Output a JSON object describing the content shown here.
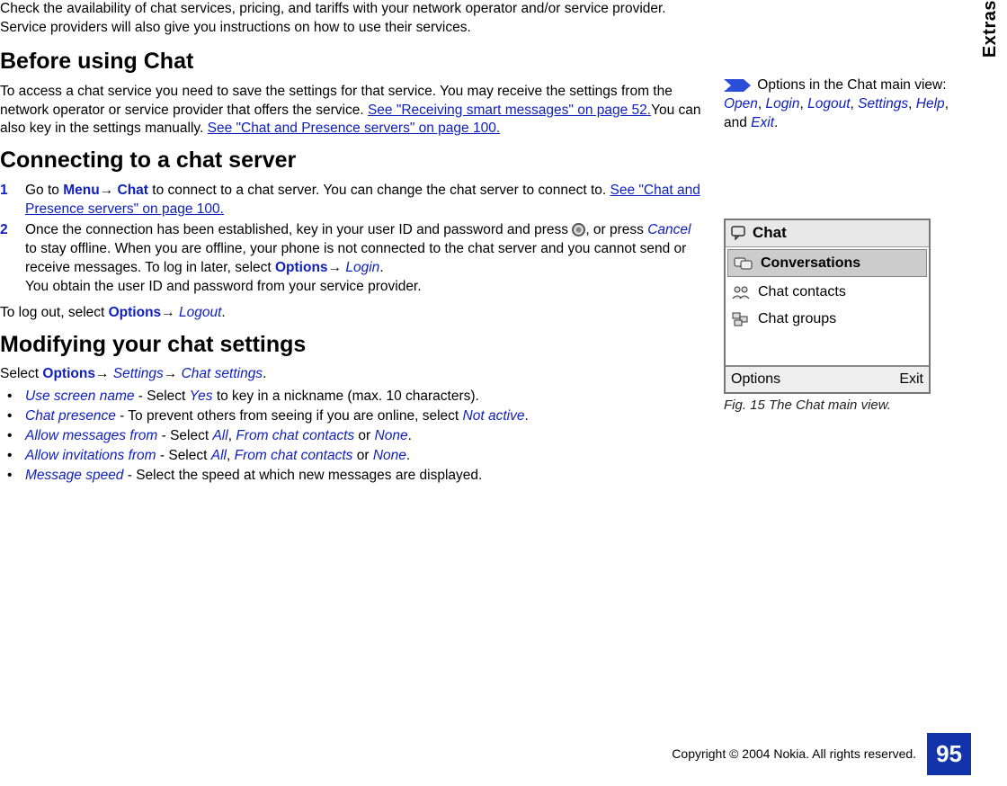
{
  "side_label": "Extras",
  "intro": "Check the availability of chat services, pricing, and tariffs with your network operator and/or service provider. Service providers will also give you instructions on how to use their services.",
  "sec1": {
    "title": "Before using Chat",
    "p1a": "To access a chat service you need to save the settings for that service. You may receive the settings from the network operator or service provider that offers the service. ",
    "link1": "See \"Receiving smart messages\" on page 52.",
    "p1b": "You can also key in the settings manually. ",
    "link2": "See \"Chat and Presence servers\" on page 100."
  },
  "sec2": {
    "title": "Connecting to a chat server",
    "step1a": "Go to ",
    "menu1": "Menu",
    "menu2": "Chat",
    "step1b": " to connect to a chat server. You can change the chat server to connect to. ",
    "step1link": "See \"Chat and Presence servers\" on page 100.",
    "step2a": "Once the connection has been established, key in your user ID and password and press ",
    "step2b": ", or press ",
    "cancel": "Cancel",
    "step2c": " to stay offline. When you are offline, your phone is not connected to the chat server and you cannot send or receive messages. To log in later, select ",
    "options": "Options",
    "login": "Login",
    "step2d": ".",
    "step2e": "You obtain the user ID and password from your service provider.",
    "logout_pre": "To log out, select ",
    "logout": "Logout",
    "period": "."
  },
  "sec3": {
    "title": "Modifying your chat settings",
    "p1a": "Select ",
    "settings": "Settings",
    "chat_settings": "Chat settings",
    "b1_key": "Use screen name",
    "b1_txt1": " - Select ",
    "b1_yes": "Yes",
    "b1_txt2": " to key in a nickname (max. 10 characters).",
    "b2_key": "Chat presence",
    "b2_txt1": " - To prevent others from seeing if you are online, select ",
    "b2_na": "Not active",
    "b3_key": "Allow messages from",
    "b3_txt1": " - Select ",
    "all": "All",
    "comma": ", ",
    "fcc": "From chat contacts",
    "or": " or ",
    "none": "None",
    "b4_key": "Allow invitations from",
    "b5_key": "Message speed",
    "b5_txt": " - Select the speed at which new messages are displayed."
  },
  "callout": {
    "pre": " Options in the Chat main view: ",
    "open": "Open",
    "login": "Login",
    "logout": "Logout",
    "settings": "Settings",
    "help": "Help",
    "and": ", and ",
    "exit": "Exit"
  },
  "screenshot": {
    "title": "Chat",
    "row1": "Conversations",
    "row2": "Chat contacts",
    "row3": "Chat groups",
    "sk_left": "Options",
    "sk_right": "Exit"
  },
  "fig_caption": "Fig. 15 The Chat main view.",
  "footer": {
    "copy": "Copyright © 2004 Nokia. All rights reserved.",
    "page": "95"
  }
}
